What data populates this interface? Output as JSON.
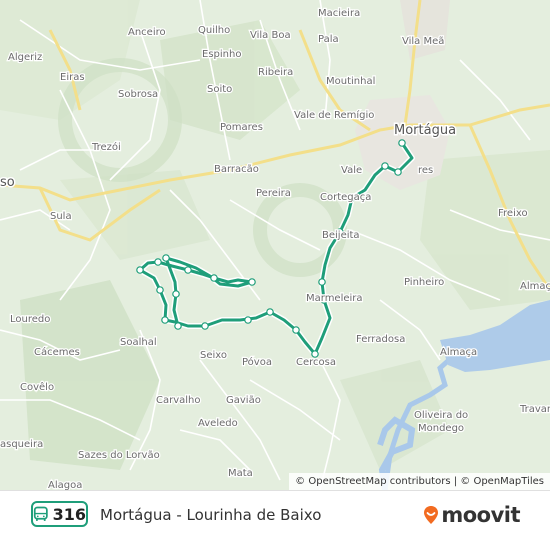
{
  "map": {
    "places": [
      {
        "id": "macieira",
        "label": "Macieira"
      },
      {
        "id": "anceiro",
        "label": "Anceiro"
      },
      {
        "id": "quilho",
        "label": "Quilho"
      },
      {
        "id": "vila-boa",
        "label": "Vila Boa"
      },
      {
        "id": "pala",
        "label": "Pala"
      },
      {
        "id": "vila-mea",
        "label": "Vila Meã"
      },
      {
        "id": "algeriz",
        "label": "Algeriz"
      },
      {
        "id": "espinho",
        "label": "Espinho"
      },
      {
        "id": "ribeira",
        "label": "Ribeira"
      },
      {
        "id": "eiras",
        "label": "Eiras"
      },
      {
        "id": "moutinhal",
        "label": "Moutinhal"
      },
      {
        "id": "sobrosa",
        "label": "Sobrosa"
      },
      {
        "id": "soito",
        "label": "Soito"
      },
      {
        "id": "vale-de-remigio",
        "label": "Vale de Remígio"
      },
      {
        "id": "pomares",
        "label": "Pomares"
      },
      {
        "id": "mortagua",
        "label": "Mortágua"
      },
      {
        "id": "trezoi",
        "label": "Trezói"
      },
      {
        "id": "vale-acores",
        "label": "Vale"
      },
      {
        "id": "acores-suffix",
        "label": "res"
      },
      {
        "id": "barracao",
        "label": "Barracão"
      },
      {
        "id": "pereira",
        "label": "Pereira"
      },
      {
        "id": "cortegaca",
        "label": "Cortegaça"
      },
      {
        "id": "sula",
        "label": "Sula"
      },
      {
        "id": "freixo",
        "label": "Freixo"
      },
      {
        "id": "beijeita",
        "label": "Beijeita"
      },
      {
        "id": "pinheiro",
        "label": "Pinheiro"
      },
      {
        "id": "almaca-top",
        "label": "Almaç"
      },
      {
        "id": "marmeleira",
        "label": "Marmeleira"
      },
      {
        "id": "loredo",
        "label": "Louredo"
      },
      {
        "id": "ferradosa",
        "label": "Ferradosa"
      },
      {
        "id": "almaca",
        "label": "Almaça"
      },
      {
        "id": "cacemes",
        "label": "Cácemes"
      },
      {
        "id": "soalhal",
        "label": "Soalhal"
      },
      {
        "id": "seixo",
        "label": "Seixo"
      },
      {
        "id": "povoa",
        "label": "Póvoa"
      },
      {
        "id": "cercosa",
        "label": "Cercosa"
      },
      {
        "id": "covelo",
        "label": "Covêlo"
      },
      {
        "id": "carvalho",
        "label": "Carvalho"
      },
      {
        "id": "gaviao",
        "label": "Gavião"
      },
      {
        "id": "oliveira",
        "label": "Oliveira do"
      },
      {
        "id": "mondego",
        "label": "Mondego"
      },
      {
        "id": "travanca",
        "label": "Travan"
      },
      {
        "id": "aveledo",
        "label": "Aveledo"
      },
      {
        "id": "sazes",
        "label": "Sazes do Lorvão"
      },
      {
        "id": "mata",
        "label": "Mata"
      },
      {
        "id": "asqueira",
        "label": "asqueira"
      },
      {
        "id": "alagoa",
        "label": "Alagoa"
      },
      {
        "id": "left-so",
        "label": "so"
      },
      {
        "id": "almaca2",
        "label": "Almaç"
      }
    ],
    "route_color": "#1f9e7a",
    "stops_count": 24
  },
  "attribution": {
    "copyright": "©",
    "osm_contrib": "OpenStreetMap contributors",
    "sep": " | © ",
    "omt": "OpenMapTiles"
  },
  "footer": {
    "route_number": "316",
    "route_name": "Mortágua - Lourinha de Baixo",
    "brand": "moovit",
    "brand_color": "#f26b21",
    "bus_icon_color": "#1f9e7a"
  }
}
